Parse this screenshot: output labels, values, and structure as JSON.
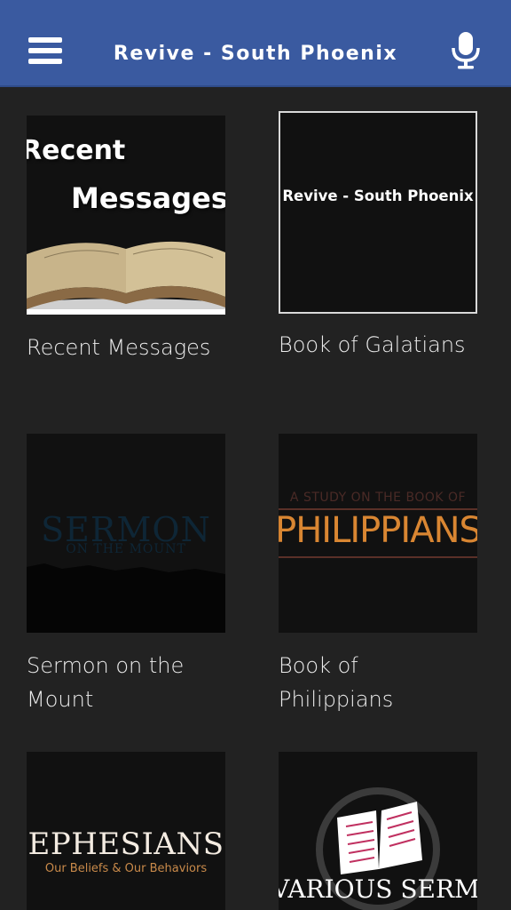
{
  "app_bar": {
    "title": "Revive - South Phoenix",
    "menu_icon": "hamburger-menu-icon",
    "mic_icon": "microphone-icon",
    "background": "#3a5aa0"
  },
  "series": [
    {
      "label": "Recent Messages",
      "art": {
        "line1": "Recent",
        "line2": "Messages"
      }
    },
    {
      "label": "Book of Galatians",
      "art": {
        "text": "Revive - South Phoenix"
      }
    },
    {
      "label": "Sermon on the Mount",
      "art": {
        "line1": "SERMON",
        "line2": "ON THE MOUNT"
      }
    },
    {
      "label": "Book of Philippians",
      "art": {
        "line1": "A STUDY ON THE BOOK OF",
        "line2": "PHILIPPIANS"
      }
    },
    {
      "label": "",
      "art": {
        "line1": "EPHESIANS",
        "line2": "Our Beliefs & Our Behaviors"
      }
    },
    {
      "label": "",
      "art": {
        "line1": "VARIOUS SERMONS",
        "icon": "open-book-icon"
      }
    }
  ]
}
